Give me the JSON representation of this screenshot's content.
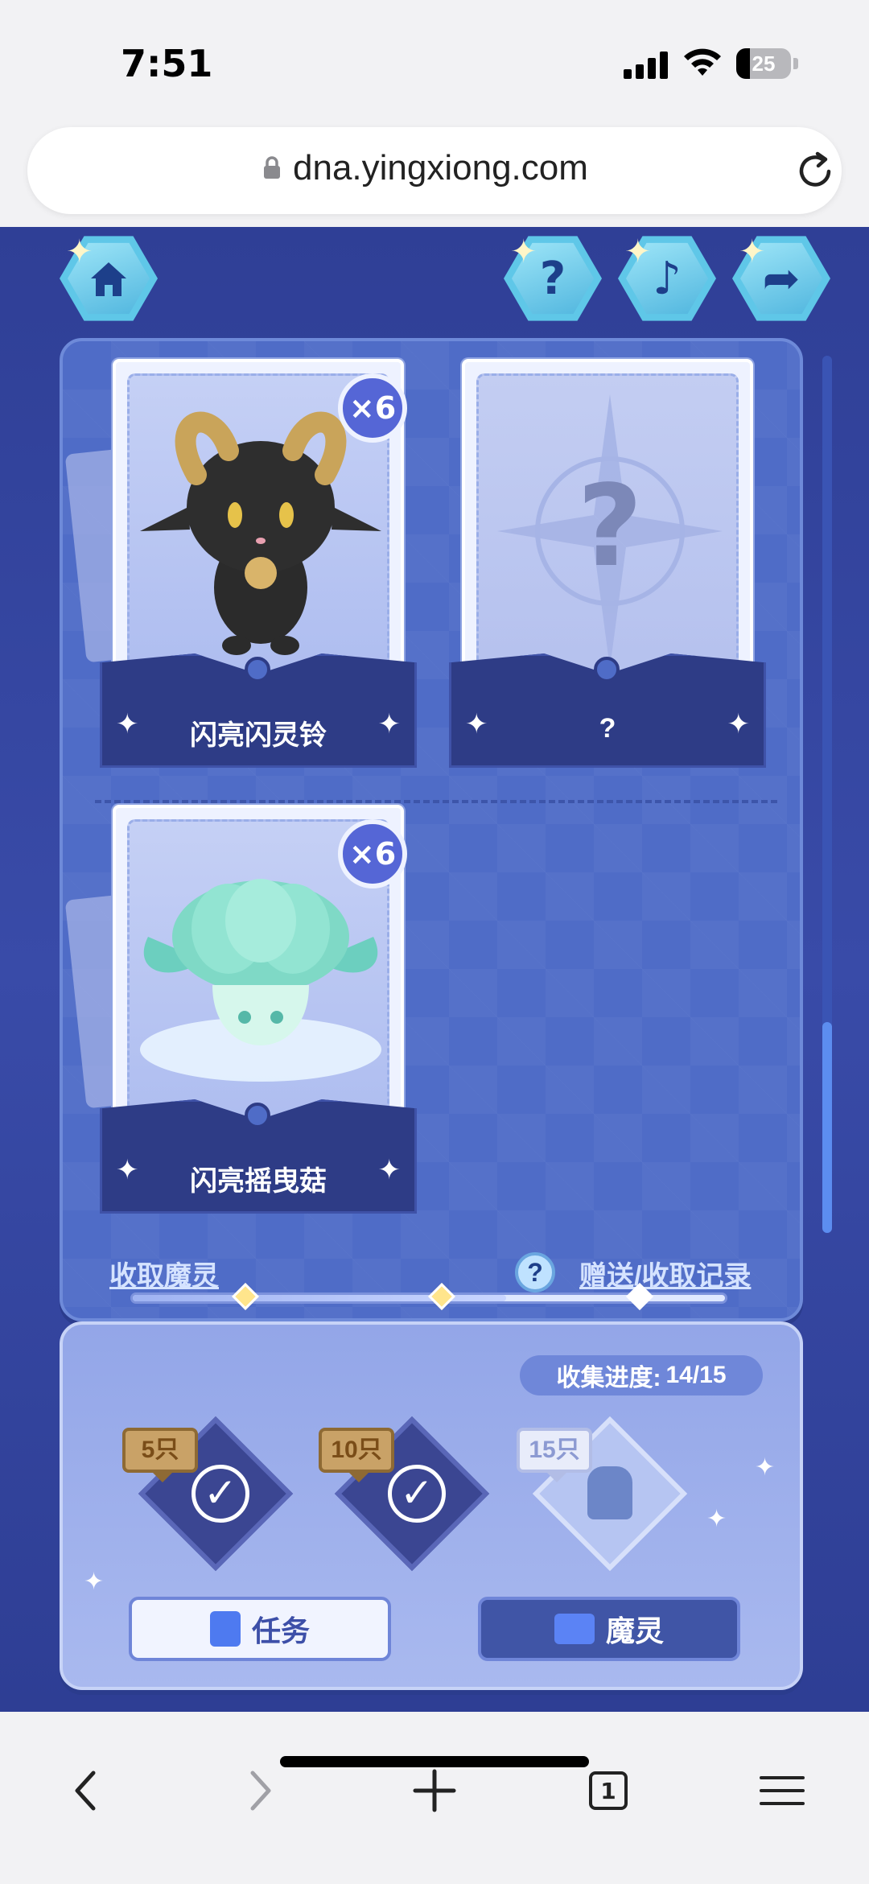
{
  "status": {
    "time": "7:51",
    "battery": "25",
    "battery_fraction": 0.25
  },
  "browser": {
    "url": "dna.yingxiong.com"
  },
  "top_buttons": {
    "home_icon": "home-icon",
    "help_glyph": "?",
    "music_glyph": "♪",
    "share_glyph": "➦"
  },
  "cards": [
    {
      "name": "闪亮闪灵铃",
      "count": "×6",
      "illustration": "black-goat-spirit"
    },
    {
      "name": "?",
      "count": "",
      "illustration": "unknown-spirit"
    },
    {
      "name": "闪亮摇曳菇",
      "count": "×6",
      "illustration": "green-mushroom-spirit"
    }
  ],
  "links": {
    "receive": "收取魔灵",
    "records": "赠送/收取记录",
    "help_glyph": "?"
  },
  "progress": {
    "label": "收集进度:",
    "value": "14/15",
    "fraction": 0.63,
    "milestones": [
      {
        "tag": "5只",
        "claimed": true
      },
      {
        "tag": "10只",
        "claimed": true
      },
      {
        "tag": "15只",
        "claimed": false
      }
    ]
  },
  "buttons": {
    "task": "任务",
    "spirit": "魔灵"
  },
  "scrollbar": {
    "position_fraction": 0.85
  },
  "colors": {
    "accent": "#4f6cc7",
    "link": "#d5e3ff",
    "badge": "#5566d6"
  }
}
